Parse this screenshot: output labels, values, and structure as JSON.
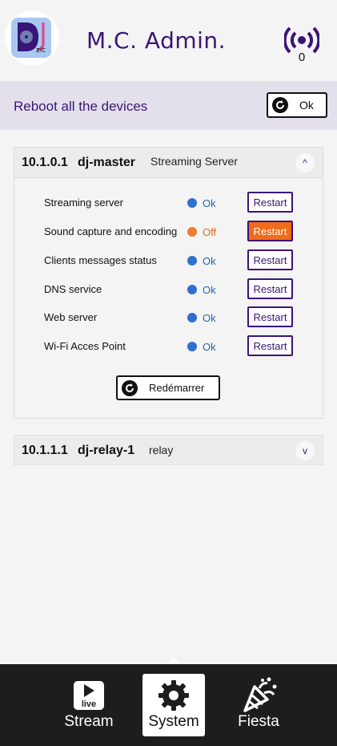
{
  "header": {
    "logo_text": "zic",
    "title": "M.C. Admin.",
    "broadcast_count": "0"
  },
  "reboot": {
    "label": "Reboot all the devices",
    "ok_label": "Ok"
  },
  "devices": [
    {
      "ip": "10.1.0.1",
      "name": "dj-master",
      "role": "Streaming Server",
      "expanded": true,
      "chevron": "^",
      "services": [
        {
          "label": "Streaming server",
          "status": "Ok",
          "status_color": "#1f68b0",
          "dot_color": "#2f6fd0",
          "restart_label": "Restart"
        },
        {
          "label": "Sound capture and encoding",
          "status": "Off",
          "status_color": "#e0651c",
          "dot_color": "#f07b32",
          "restart_label": "Restart"
        },
        {
          "label": "Clients messages status",
          "status": "Ok",
          "status_color": "#1f68b0",
          "dot_color": "#2f6fd0",
          "restart_label": "Restart"
        },
        {
          "label": "DNS service",
          "status": "Ok",
          "status_color": "#1f68b0",
          "dot_color": "#2f6fd0",
          "restart_label": "Restart"
        },
        {
          "label": "Web server",
          "status": "Ok",
          "status_color": "#1f68b0",
          "dot_color": "#2f6fd0",
          "restart_label": "Restart"
        },
        {
          "label": "Wi-Fi Acces Point",
          "status": "Ok",
          "status_color": "#1f68b0",
          "dot_color": "#2f6fd0",
          "restart_label": "Restart"
        }
      ],
      "reboot_label": "Redémarrer"
    },
    {
      "ip": "10.1.1.1",
      "name": "dj-relay-1",
      "role": "relay",
      "expanded": false,
      "chevron": "v"
    }
  ],
  "nav": {
    "items": [
      {
        "label": "Stream",
        "icon": "live-play-icon",
        "active": false
      },
      {
        "label": "System",
        "icon": "gear-icon",
        "active": true
      },
      {
        "label": "Fiesta",
        "icon": "party-popper-icon",
        "active": false
      }
    ],
    "live_badge": "live"
  },
  "colors": {
    "brand": "#3b1478",
    "alert": "#f06b1b",
    "nav_bg": "#1d1d1d",
    "reboot_bar": "#e3e0ec"
  }
}
